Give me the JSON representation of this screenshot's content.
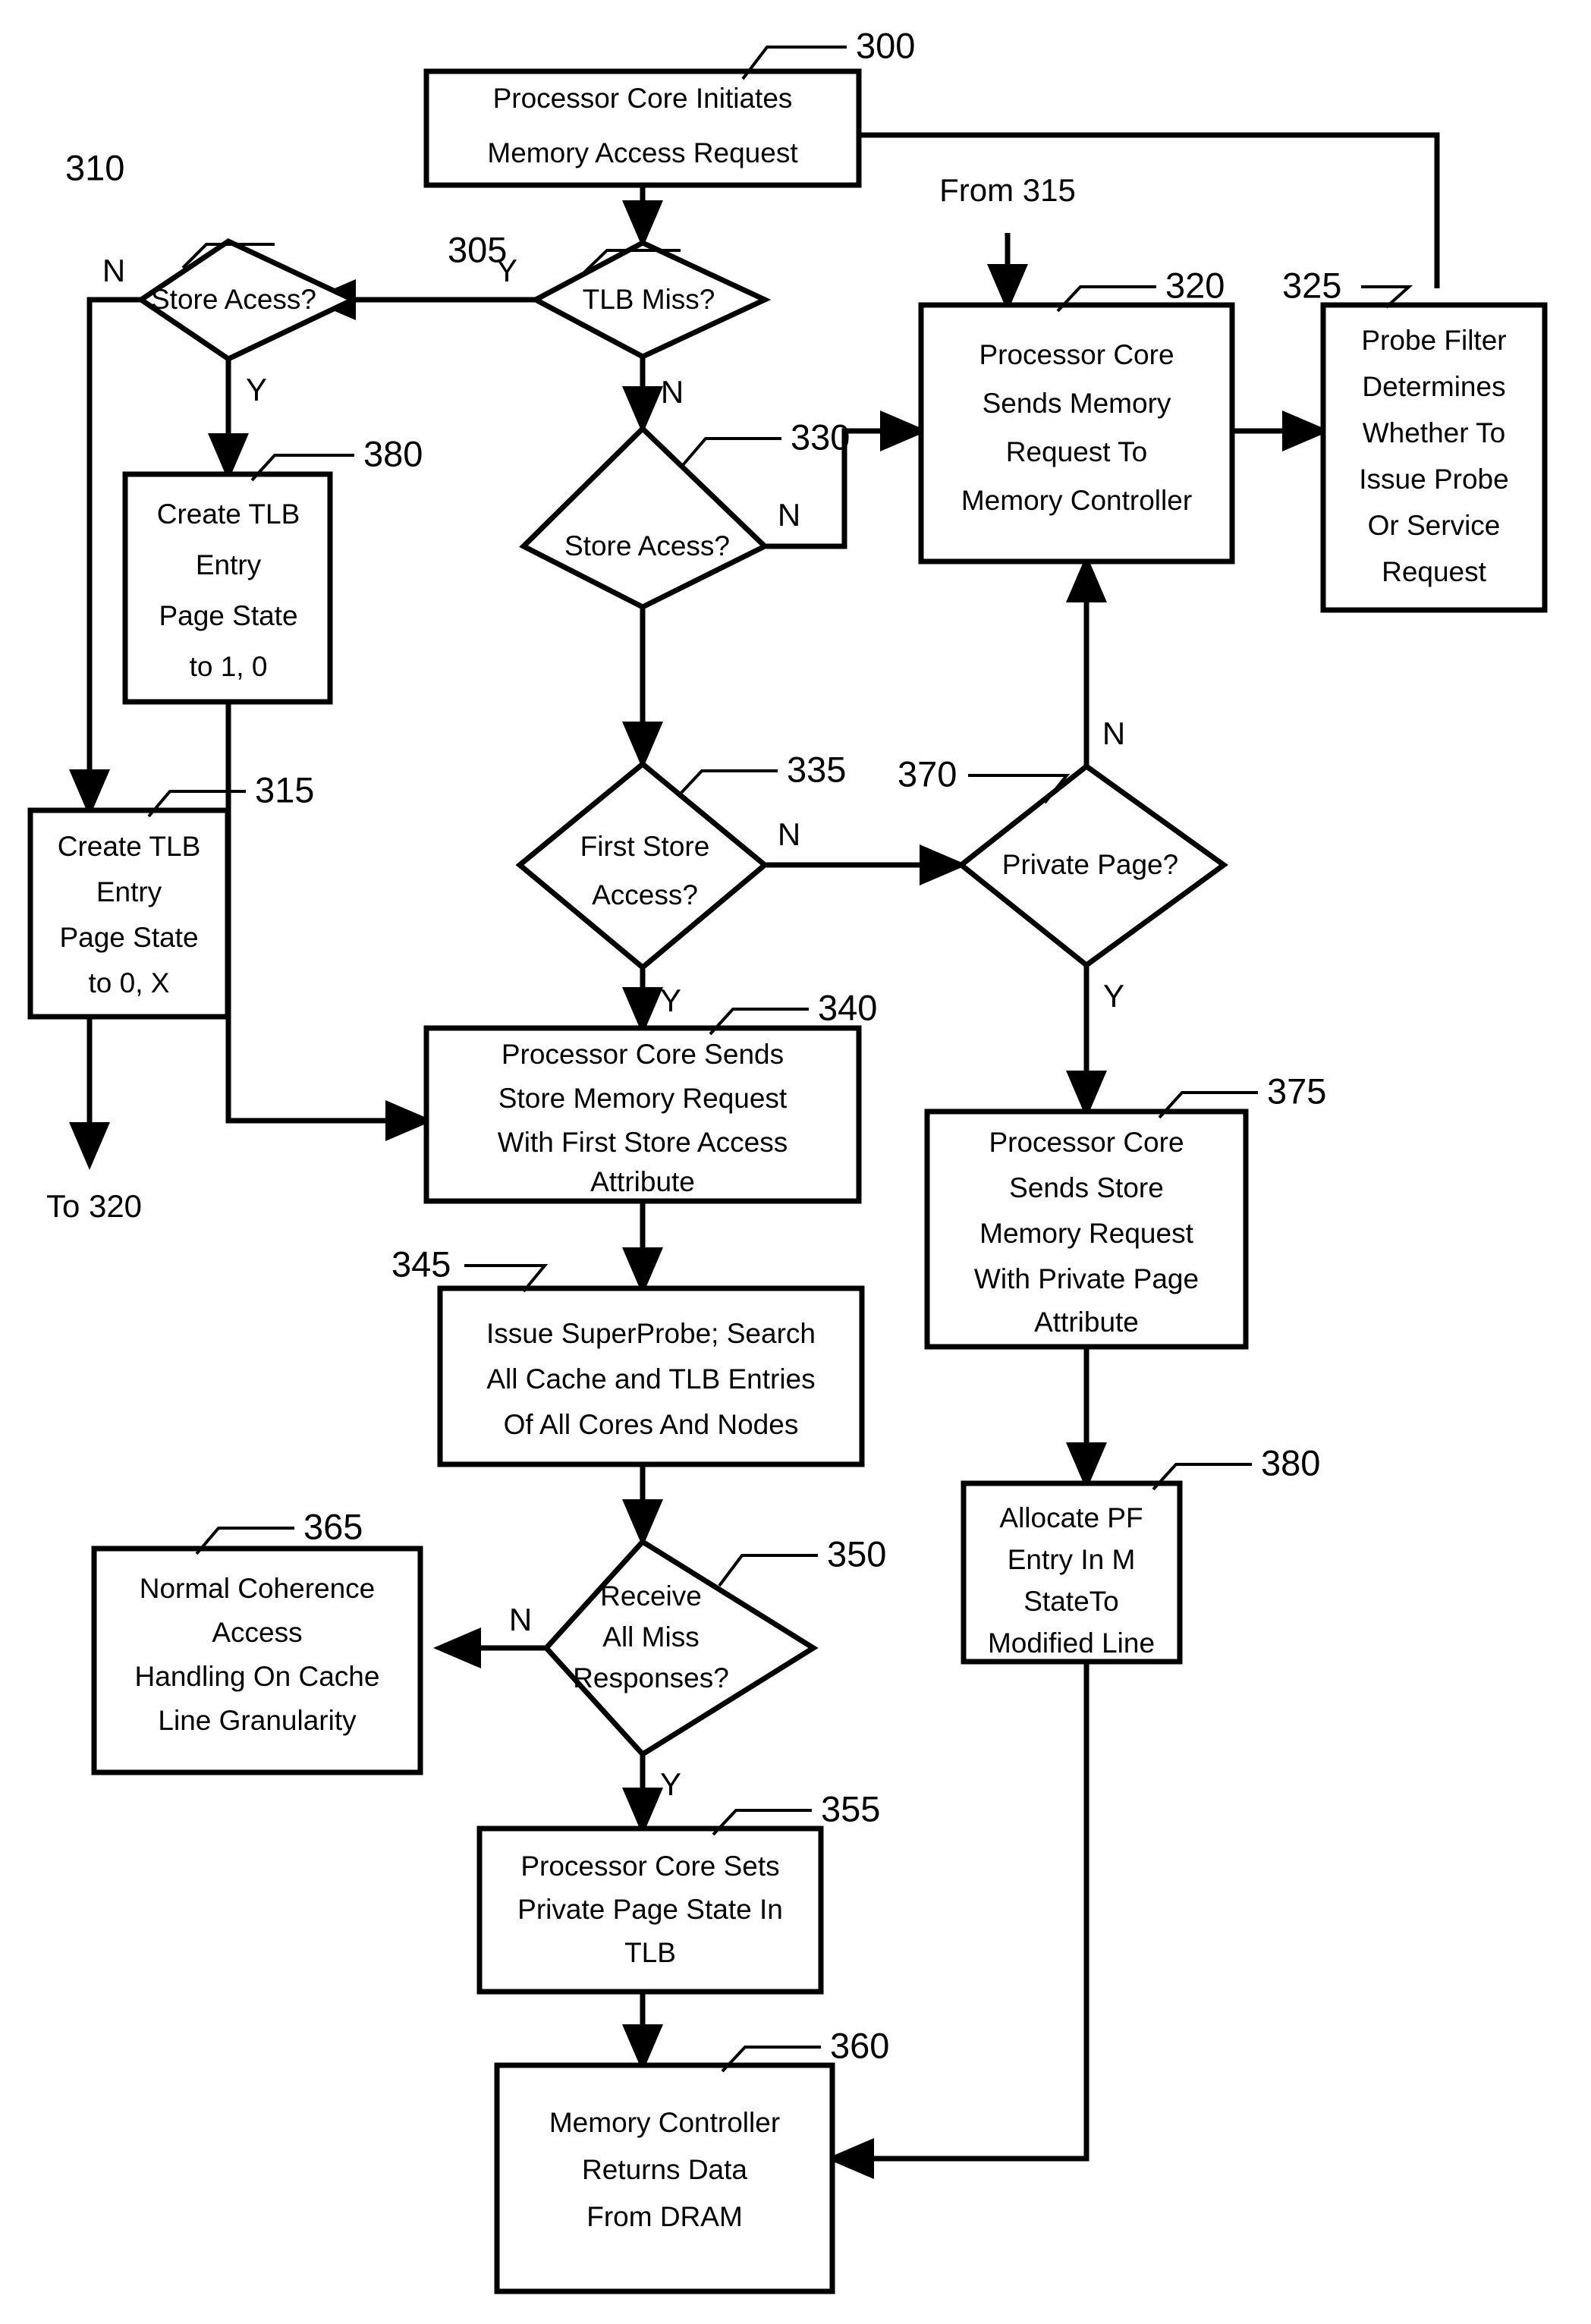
{
  "diagram": {
    "type": "flowchart",
    "title": "",
    "nodes": [
      {
        "id": "300",
        "ref": "300",
        "shape": "process",
        "lines": [
          "Processor Core Initiates",
          "Memory Access Request"
        ]
      },
      {
        "id": "305",
        "ref": "305",
        "shape": "decision",
        "lines": [
          "TLB Miss?"
        ]
      },
      {
        "id": "310",
        "ref": "310",
        "shape": "decision",
        "lines": [
          "Store Acess?"
        ]
      },
      {
        "id": "380a",
        "ref": "380",
        "shape": "process",
        "lines": [
          "Create TLB",
          "Entry",
          "Page State",
          "to 1, 0"
        ]
      },
      {
        "id": "315",
        "ref": "315",
        "shape": "process",
        "lines": [
          "Create TLB",
          "Entry",
          "Page State",
          "to 0, X"
        ]
      },
      {
        "id": "330",
        "ref": "330",
        "shape": "decision",
        "lines": [
          "Store Acess?"
        ]
      },
      {
        "id": "320",
        "ref": "320",
        "shape": "process",
        "lines": [
          "Processor Core",
          "Sends Memory",
          "Request  To",
          "Memory Controller"
        ]
      },
      {
        "id": "325",
        "ref": "325",
        "shape": "process",
        "lines": [
          "Probe Filter",
          "Determines",
          "Whether To",
          "Issue Probe",
          "Or Service",
          "Request"
        ]
      },
      {
        "id": "335",
        "ref": "335",
        "shape": "decision",
        "lines": [
          "First Store",
          "Access?"
        ]
      },
      {
        "id": "370",
        "ref": "370",
        "shape": "decision",
        "lines": [
          "Private Page?"
        ]
      },
      {
        "id": "340",
        "ref": "340",
        "shape": "process",
        "lines": [
          "Processor Core Sends",
          "Store Memory Request",
          "With First Store Access",
          "Attribute"
        ]
      },
      {
        "id": "375",
        "ref": "375",
        "shape": "process",
        "lines": [
          "Processor Core",
          "Sends Store",
          "Memory Request",
          "With Private Page",
          "Attribute"
        ]
      },
      {
        "id": "345",
        "ref": "345",
        "shape": "process",
        "lines": [
          "Issue SuperProbe; Search",
          "All Cache and TLB Entries",
          "Of All Cores And Nodes"
        ]
      },
      {
        "id": "380b",
        "ref": "380",
        "shape": "process",
        "lines": [
          "Allocate PF",
          "Entry In M",
          "StateTo",
          "Modified Line"
        ]
      },
      {
        "id": "350",
        "ref": "350",
        "shape": "decision",
        "lines": [
          "Receive",
          "All Miss",
          "Responses?"
        ]
      },
      {
        "id": "365",
        "ref": "365",
        "shape": "process",
        "lines": [
          "Normal Coherence",
          "Access",
          "Handling On Cache",
          "Line Granularity"
        ]
      },
      {
        "id": "355",
        "ref": "355",
        "shape": "process",
        "lines": [
          "Processor Core Sets",
          "Private Page State In",
          "TLB"
        ]
      },
      {
        "id": "360",
        "ref": "360",
        "shape": "process",
        "lines": [
          "Memory Controller",
          "Returns Data",
          "From DRAM"
        ]
      }
    ],
    "branch_labels": {
      "n305_y": "Y",
      "n305_n": "N",
      "n310_n": "N",
      "n310_y": "Y",
      "n330_n": "N",
      "n335_n": "N",
      "n335_y": "Y",
      "n370_n": "N",
      "n370_y": "Y",
      "n350_n": "N",
      "n350_y": "Y"
    },
    "off_page_notes": {
      "from_315": "From 315",
      "to_320": "To 320"
    },
    "edges": [
      {
        "from": "300",
        "to": "305",
        "label": ""
      },
      {
        "from": "305",
        "to": "310",
        "label": "Y"
      },
      {
        "from": "305",
        "to": "330",
        "label": "N"
      },
      {
        "from": "310",
        "to": "315",
        "label": "N"
      },
      {
        "from": "310",
        "to": "380a",
        "label": "Y"
      },
      {
        "from": "380a",
        "to": "340",
        "label": ""
      },
      {
        "from": "315",
        "to": "320",
        "label": "To 320"
      },
      {
        "from": "330",
        "to": "320",
        "label": "N"
      },
      {
        "from": "330",
        "to": "335",
        "label": "Y"
      },
      {
        "from": "320",
        "to": "325",
        "label": ""
      },
      {
        "from": "325",
        "to": "300",
        "label": ""
      },
      {
        "from": "335",
        "to": "370",
        "label": "N"
      },
      {
        "from": "335",
        "to": "340",
        "label": "Y"
      },
      {
        "from": "370",
        "to": "320",
        "label": "N"
      },
      {
        "from": "370",
        "to": "375",
        "label": "Y"
      },
      {
        "from": "340",
        "to": "345",
        "label": ""
      },
      {
        "from": "345",
        "to": "350",
        "label": ""
      },
      {
        "from": "350",
        "to": "365",
        "label": "N"
      },
      {
        "from": "350",
        "to": "355",
        "label": "Y"
      },
      {
        "from": "355",
        "to": "360",
        "label": ""
      },
      {
        "from": "375",
        "to": "380b",
        "label": ""
      },
      {
        "from": "380b",
        "to": "360",
        "label": ""
      }
    ]
  },
  "colors": {
    "line": "#000000",
    "fill": "#ffffff",
    "text": "#000000"
  }
}
